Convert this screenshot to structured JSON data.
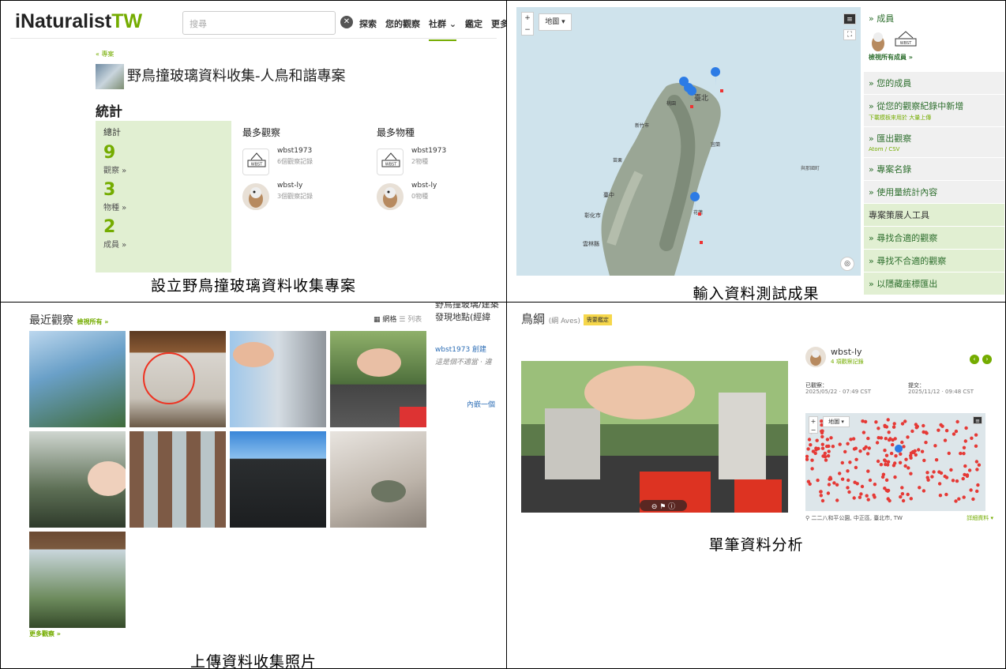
{
  "panel1": {
    "logo_main": "iNaturalist",
    "logo_suffix": "TW",
    "search_placeholder": "搜尋",
    "nav": [
      "探索",
      "您的觀察",
      "社群 ⌄",
      "鑑定",
      "更多"
    ],
    "breadcrumb": "« 專案",
    "project_title": "野鳥撞玻璃資料收集-人鳥和諧專案",
    "stats_heading": "統計",
    "totals_label": "總計",
    "totals": [
      {
        "value": "9",
        "label": "觀察 »"
      },
      {
        "value": "3",
        "label": "物種 »"
      },
      {
        "value": "2",
        "label": "成員 »"
      }
    ],
    "top_observers_heading": "最多觀察",
    "top_observers": [
      {
        "name": "wbst1973",
        "detail": "6個觀察記錄"
      },
      {
        "name": "wbst-ly",
        "detail": "3個觀察記錄"
      }
    ],
    "top_species_heading": "最多物種",
    "top_species": [
      {
        "name": "wbst1973",
        "detail": "2物種"
      },
      {
        "name": "wbst-ly",
        "detail": "0物種"
      }
    ],
    "caption": "設立野鳥撞玻璃資料收集專案"
  },
  "panel2": {
    "map_type": "地圖 ▾",
    "places": [
      "臺北",
      "桃園",
      "新竹市",
      "苗栗",
      "臺中",
      "彰化市",
      "雲林縣",
      "花蓮",
      "宜蘭",
      "與那國町"
    ],
    "side": [
      {
        "label": "» 成員",
        "sub": ""
      },
      {
        "label": "» 您的成員",
        "sub": ""
      },
      {
        "label": "» 從您的觀察紀錄中新增",
        "sub": "下載模板來用於 大量上傳"
      },
      {
        "label": "» 匯出觀察",
        "sub": "Atom / CSV"
      },
      {
        "label": "» 專案名錄",
        "sub": ""
      },
      {
        "label": "» 使用量統計內容",
        "sub": ""
      }
    ],
    "view_all_members": "檢視所有成員 »",
    "curator_heading": "專案策展人工具",
    "curator_tools": [
      "» 尋找合適的觀察",
      "» 尋找不合適的觀察",
      "» 以隱藏座標匯出"
    ],
    "caption": "輸入資料測試成果"
  },
  "panel3": {
    "heading": "最近觀察",
    "view_all": "檢視所有 »",
    "view_grid": "網格",
    "view_list": "列表",
    "side_lines": [
      "野鳥撞玻璃/建築",
      "發現地點(經緯",
      "wbst1973 創建",
      "這是個不適當 · 違",
      "內嵌一個"
    ],
    "more": "更多觀察 »",
    "caption": "上傳資料收集照片"
  },
  "panel4": {
    "taxon": "鳥綱",
    "taxon_sci": "(綱 Aves)",
    "badge": "需要鑑定",
    "user": "wbst-ly",
    "user_obs": "4 項觀察記錄",
    "observed_label": "已觀察：",
    "observed_value": "2025/05/22 · 07:49 CST",
    "submitted_label": "提交：",
    "submitted_value": "2025/11/12 · 09:48 CST",
    "map_type": "地圖 ▾",
    "location": "二二八和平公園, 中正區, 臺北市, TW",
    "details_link": "詳細資料 ▾",
    "caption": "單筆資料分析"
  }
}
